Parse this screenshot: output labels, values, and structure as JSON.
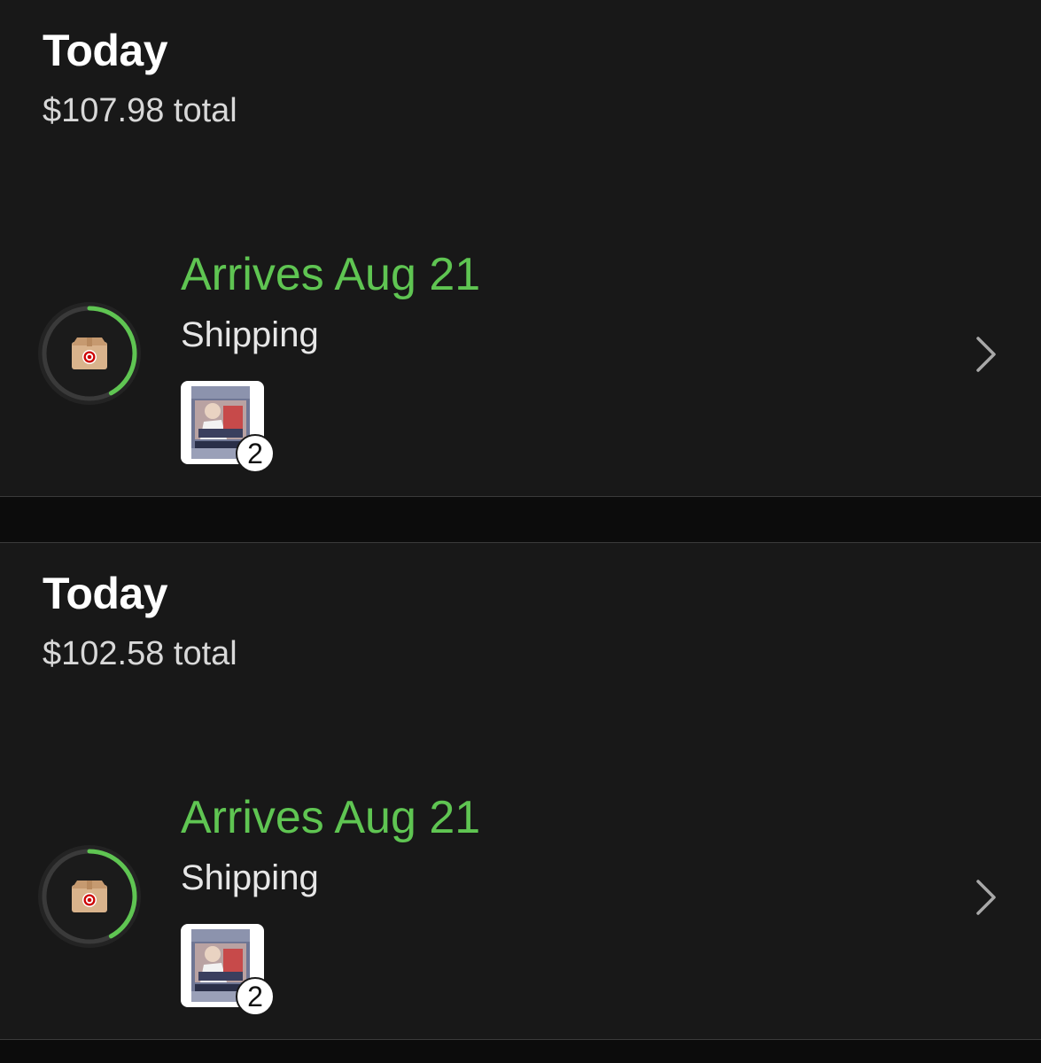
{
  "orders": [
    {
      "day_label": "Today",
      "total_text": "$107.98 total",
      "shipment": {
        "arrival_text": "Arrives Aug 21",
        "status_text": "Shipping",
        "item_quantity": "2",
        "progress_fraction": 0.42,
        "status_icon": "box-with-target-logo-icon",
        "chevron_icon": "chevron-right-icon"
      }
    },
    {
      "day_label": "Today",
      "total_text": "$102.58 total",
      "shipment": {
        "arrival_text": "Arrives Aug 21",
        "status_text": "Shipping",
        "item_quantity": "2",
        "progress_fraction": 0.42,
        "status_icon": "box-with-target-logo-icon",
        "chevron_icon": "chevron-right-icon"
      }
    }
  ],
  "colors": {
    "background": "#0c0c0c",
    "card": "#181818",
    "accent_green": "#5fc552",
    "ring_track": "#3a3a3a",
    "target_red": "#cc0000",
    "box_tan": "#d9b38c"
  }
}
